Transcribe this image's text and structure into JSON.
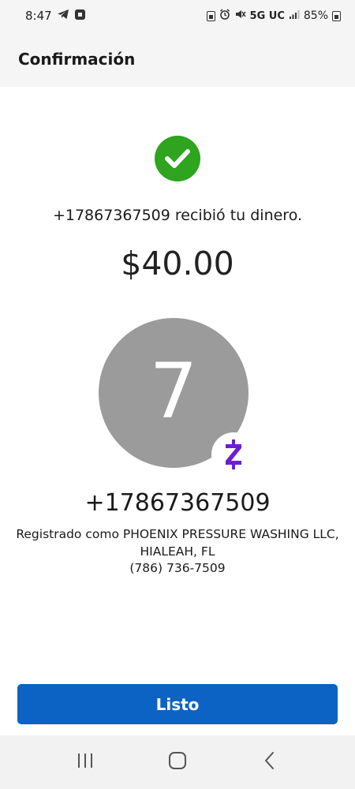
{
  "status_bar": {
    "time": "8:47",
    "network": "5G UC",
    "battery": "85%"
  },
  "header": {
    "title": "Confirmación"
  },
  "confirmation": {
    "received_text": "+17867367509 recibió tu dinero.",
    "amount": "$40.00"
  },
  "recipient": {
    "avatar_initial": "7",
    "phone": "+17867367509",
    "registered_line1": "Registrado como PHOENIX PRESSURE WASHING LLC,",
    "registered_line2": "HIALEAH, FL",
    "phone_formatted": "(786) 736-7509"
  },
  "actions": {
    "done_label": "Listo"
  },
  "colors": {
    "accent": "#0c63c4",
    "success": "#2ea41f",
    "brand_zelle": "#6d1ed4",
    "avatar_bg": "#9b9b9b"
  },
  "icons": [
    "telegram-icon",
    "chase-icon",
    "battery-saver-icon",
    "alarm-icon",
    "mute-icon",
    "signal-icon",
    "battery-icon",
    "check-icon",
    "zelle-icon",
    "recents-icon",
    "home-icon",
    "back-icon"
  ]
}
